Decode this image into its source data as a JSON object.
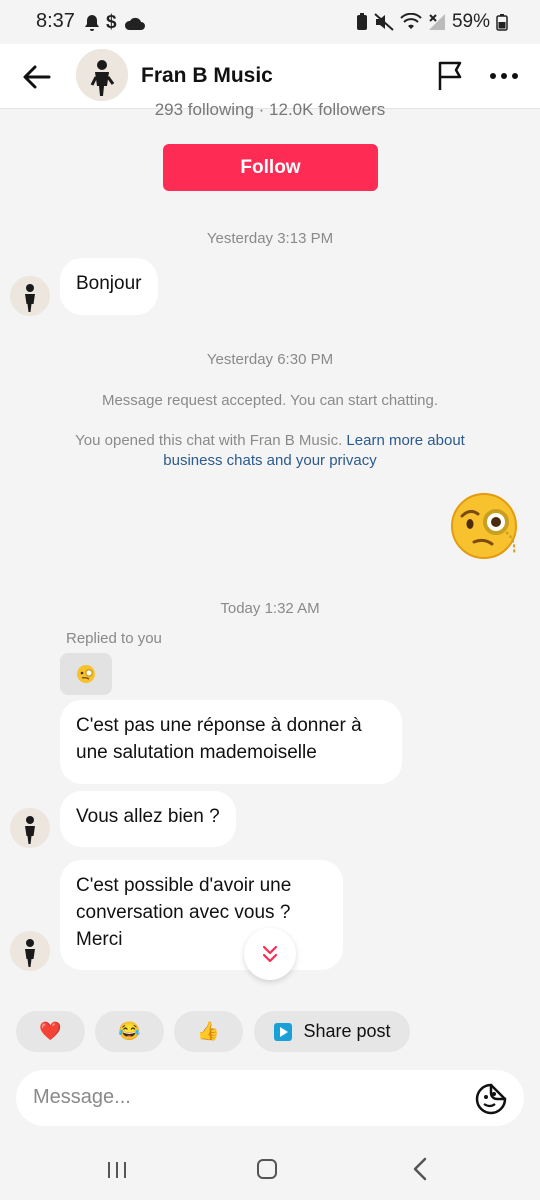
{
  "status_bar": {
    "time": "8:37",
    "battery": "59%",
    "icons": [
      "bell-icon",
      "dollar-icon",
      "cloud-icon",
      "battery-saver-icon",
      "mute-icon",
      "wifi-icon",
      "no-signal-icon",
      "battery-icon"
    ]
  },
  "header": {
    "title": "Fran B Music",
    "icons": [
      "back-arrow-icon",
      "flag-icon",
      "more-icon"
    ]
  },
  "profile": {
    "follow_stats": "293 following · 12.0K followers",
    "follow_label": "Follow"
  },
  "chat": {
    "timestamp_1": "Yesterday 3:13 PM",
    "msg_1": "Bonjour",
    "timestamp_2": "Yesterday 6:30 PM",
    "system_1": "Message request accepted. You can start chatting.",
    "system_2_text": "You opened this chat with Fran B Music. ",
    "system_2_link": "Learn more about business chats and your privacy",
    "sent_sticker": "monocle-face-emoji",
    "timestamp_3": "Today 1:32 AM",
    "replied_label": "Replied to you",
    "msg_2": "C'est pas une réponse à donner à une salutation mademoiselle",
    "msg_3": "Vous allez bien ?",
    "msg_4": "C'est possible d'avoir une conversation avec vous ? Merci"
  },
  "quick_replies": [
    {
      "emoji": "❤️"
    },
    {
      "emoji": "😂"
    },
    {
      "emoji": "👍"
    },
    {
      "label": "Share post"
    }
  ],
  "composer": {
    "placeholder": "Message..."
  },
  "colors": {
    "accent": "#fe2c55",
    "link": "#2b5a8c",
    "background": "#f4f4f4"
  }
}
